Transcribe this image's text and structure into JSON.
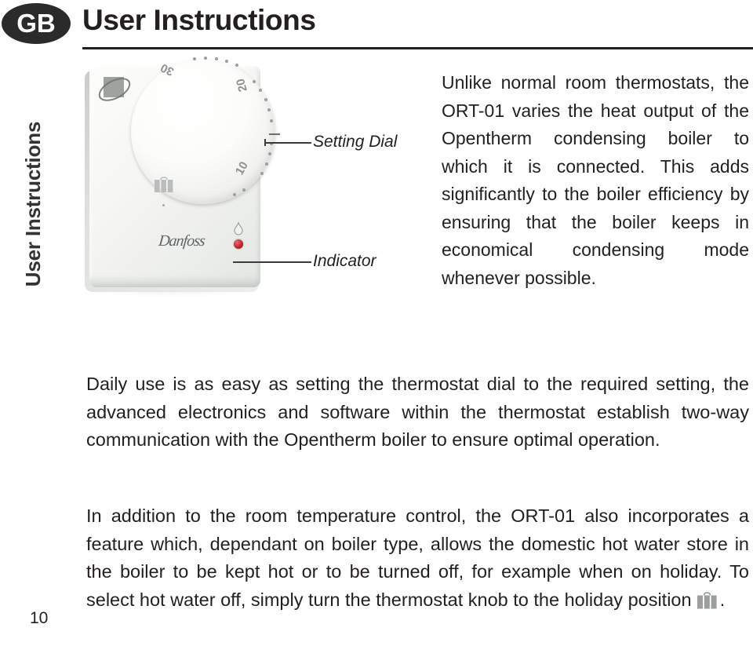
{
  "header": {
    "badge": "GB",
    "title": "User Instructions"
  },
  "side_tab": {
    "label": "User Instructions"
  },
  "figure": {
    "product_logo": "danfoss-logo",
    "brand_text": "Danfoss",
    "dial": {
      "numbers": [
        "30",
        "20",
        "10"
      ],
      "holiday_icon": "suitcase-icon"
    },
    "indicator_icon": "flame-icon",
    "led_color": "#c1272d",
    "callouts": [
      {
        "label": "Setting Dial"
      },
      {
        "label": "Indicator"
      }
    ]
  },
  "body": {
    "paragraph_1": "Unlike normal room thermostats, the ORT-01 varies the heat output of the Opentherm condensing boiler to which it is connected. This adds significantly to the boiler efficiency by ensuring that the boiler keeps in economical condensing mode whenever possible.",
    "paragraph_2": "Daily use is as easy as setting the thermostat dial to the required setting, the advanced electronics and software within the thermostat establish two-way communication with the Opentherm boiler to ensure optimal operation.",
    "paragraph_3_before_icon": "In addition to the room temperature control, the ORT-01 also incorporates a feature which, dependant on boiler type, allows the domestic hot water store in the boiler to be kept hot or to be turned off, for example when on holiday. To select hot water off, simply turn the thermostat knob to the holiday position",
    "paragraph_3_after_icon": "."
  },
  "footer": {
    "page_number": "10"
  },
  "colors": {
    "text": "#231f20",
    "badge_bg": "#2b2b2b",
    "led": "#c1272d",
    "icon_gray": "#9a9e9c"
  }
}
